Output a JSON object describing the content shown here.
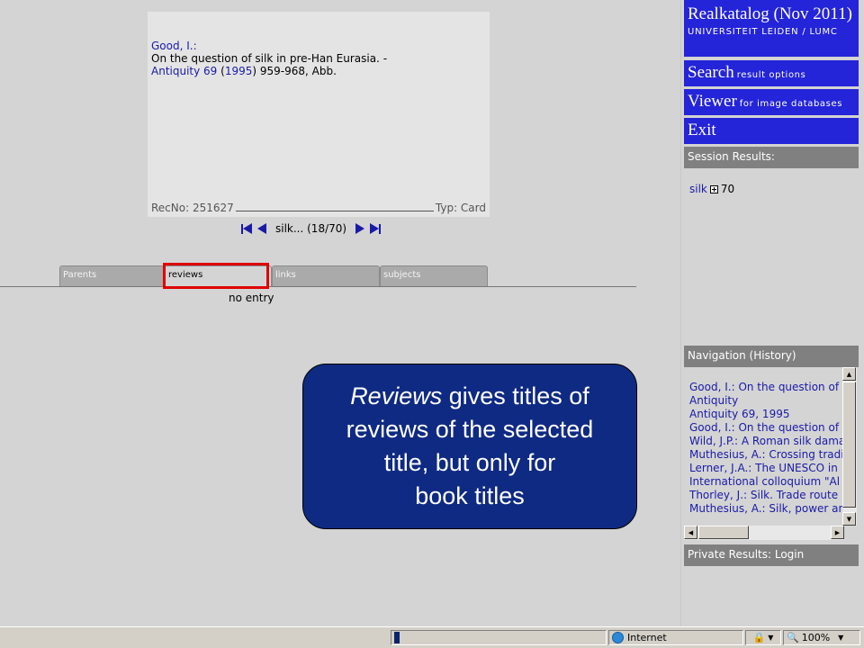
{
  "record": {
    "author": "Good, I.:",
    "title": "On the question of silk in pre-Han Eurasia. -",
    "journal_name": "Antiquity 69",
    "year": "1995",
    "pages": ") 959-968, Abb.",
    "recno": "RecNo: 251627",
    "type": "Typ: Card"
  },
  "pager": {
    "label": "silk... (18/70)"
  },
  "tabs": [
    {
      "label": "Parents"
    },
    {
      "label": "reviews"
    },
    {
      "label": "links"
    },
    {
      "label": "subjects"
    }
  ],
  "no_entry": "no entry",
  "callout": {
    "emphasis": "Reviews",
    "line1_rest": " gives titles of",
    "line2": "reviews of the selected",
    "line3": "title, but only for",
    "line4": "book titles"
  },
  "sidebar": {
    "header_title": "Realkatalog (Nov 2011)",
    "header_sub": "UNIVERSITEIT LEIDEN / LUMC",
    "search_label": "Search",
    "search_sub": "result options",
    "viewer_label": "Viewer",
    "viewer_sub": "for image databases",
    "exit_label": "Exit",
    "session_title": "Session Results:",
    "session_term": "silk",
    "session_count": "70",
    "nav_title": "Navigation (History)",
    "history": [
      "Good, I.: On the question of silk",
      "Antiquity",
      "Antiquity 69, 1995",
      "Good, I.: On the question of silk",
      "Wild, J.P.: A Roman silk damask",
      "Muthesius, A.: Crossing traditions",
      "Lerner, J.A.: The UNESCO in",
      "International colloquium \"Al",
      "Thorley, J.: Silk. Trade route",
      "Muthesius, A.: Silk, power and"
    ],
    "private_title": "Private Results: Login"
  },
  "statusbar": {
    "zone": "Internet",
    "zoom": "100%"
  },
  "colors": {
    "accent_blue": "#2424d8",
    "callout_bg": "#0f2a82",
    "highlight": "#e00000",
    "link": "#1a1aa8"
  }
}
